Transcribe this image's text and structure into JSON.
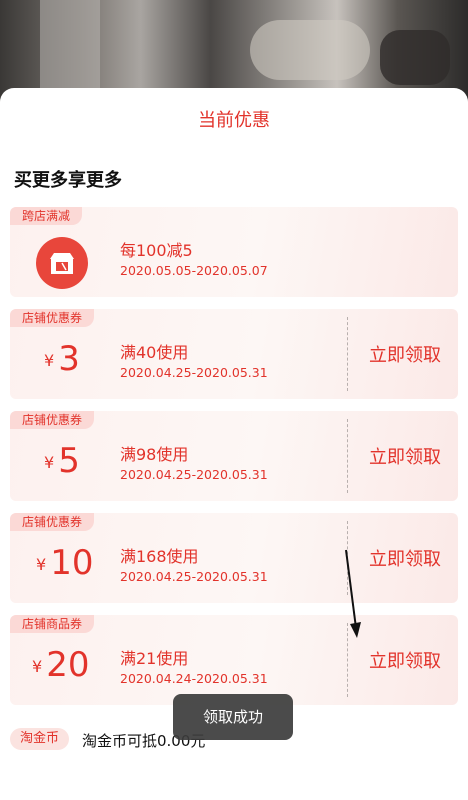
{
  "sheet": {
    "title": "当前优惠",
    "section_title": "买更多享更多"
  },
  "cards": [
    {
      "tag": "跨店满减",
      "desc": "每100减5",
      "date": "2020.05.05-2020.05.07"
    },
    {
      "tag": "店铺优惠券",
      "currency": "¥",
      "amount": "3",
      "desc": "满40使用",
      "date": "2020.04.25-2020.05.31",
      "claim": "立即领取"
    },
    {
      "tag": "店铺优惠券",
      "currency": "¥",
      "amount": "5",
      "desc": "满98使用",
      "date": "2020.04.25-2020.05.31",
      "claim": "立即领取"
    },
    {
      "tag": "店铺优惠券",
      "currency": "¥",
      "amount": "10",
      "desc": "满168使用",
      "date": "2020.04.25-2020.05.31",
      "claim": "立即领取"
    },
    {
      "tag": "店铺商品券",
      "currency": "¥",
      "amount": "20",
      "desc": "满21使用",
      "date": "2020.04.24-2020.05.31",
      "claim": "立即领取"
    }
  ],
  "coin": {
    "tag": "淘金币",
    "text": "淘金币可抵0.00元"
  },
  "toast": "领取成功",
  "colors": {
    "accent": "#e2332b",
    "tag_bg": "#fbd9d6",
    "card_bg": "#fdf1ef"
  },
  "icons": {
    "shop": "store-icon"
  }
}
